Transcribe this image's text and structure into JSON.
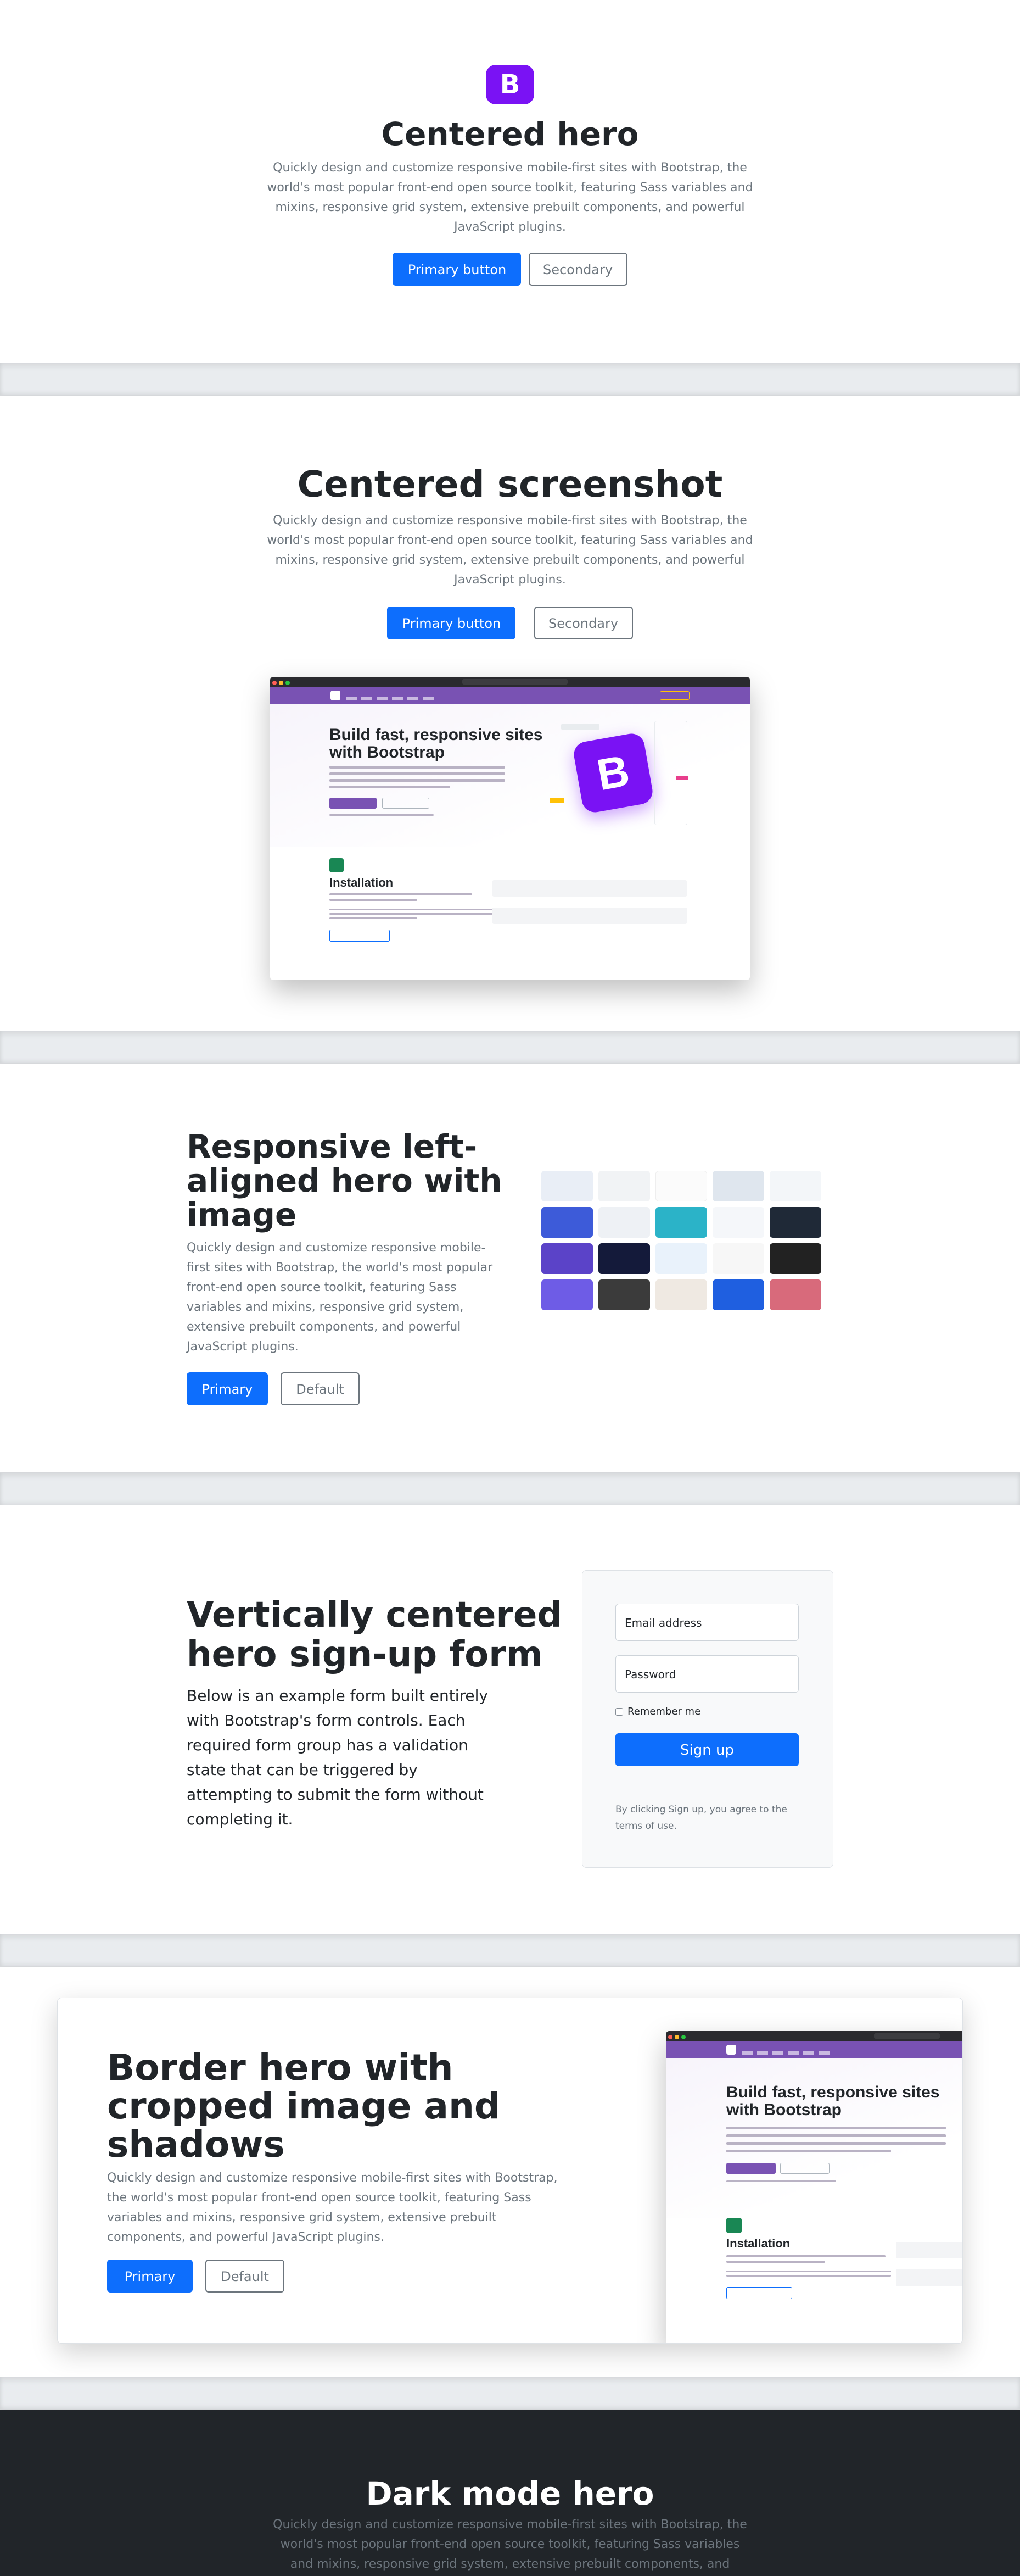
{
  "hero1": {
    "logo_letter": "B",
    "title": "Centered hero",
    "lead_lines": [
      "Quickly design and customize responsive mobile-first sites with Bootstrap, the",
      "world's most popular front-end open source toolkit, featuring Sass variables and",
      "mixins, responsive grid system, extensive prebuilt components, and powerful",
      "JavaScript plugins."
    ],
    "primary_label": "Primary button",
    "secondary_label": "Secondary"
  },
  "hero2": {
    "title": "Centered screenshot",
    "lead_lines": [
      "Quickly design and customize responsive mobile-first sites with Bootstrap, the",
      "world's most popular front-end open source toolkit, featuring Sass variables and",
      "mixins, responsive grid system, extensive prebuilt components, and powerful",
      "JavaScript plugins."
    ],
    "primary_label": "Primary button",
    "secondary_label": "Secondary",
    "screenshot": {
      "headline_1": "Build fast, responsive sites",
      "headline_2": "with Bootstrap",
      "section_title": "Installation",
      "logo_letter": "B"
    }
  },
  "hero3": {
    "title_lines": [
      "Responsive left-",
      "aligned hero with",
      "image"
    ],
    "lead_lines": [
      "Quickly design and customize responsive mobile-",
      "first sites with Bootstrap, the world's most popular",
      "front-end open source toolkit, featuring Sass",
      "variables and mixins, responsive grid system,",
      "extensive prebuilt components, and powerful",
      "JavaScript plugins."
    ],
    "primary_label": "Primary",
    "default_label": "Default"
  },
  "hero4": {
    "title_lines": [
      "Vertically centered",
      "hero sign-up form"
    ],
    "lead_lines": [
      "Below is an example form built entirely",
      "with Bootstrap's form controls. Each",
      "required form group has a validation",
      "state that can be triggered by",
      "attempting to submit the form without",
      "completing it."
    ],
    "email_placeholder": "Email address",
    "password_placeholder": "Password",
    "remember_label": "Remember me",
    "signup_label": "Sign up",
    "terms_lines": [
      "By clicking Sign up, you agree to the",
      "terms of use."
    ]
  },
  "hero5": {
    "title_lines": [
      "Border hero with",
      "cropped image and",
      "shadows"
    ],
    "lead_lines": [
      "Quickly design and customize responsive mobile-first sites with Bootstrap,",
      "the world's most popular front-end open source toolkit, featuring Sass",
      "variables and mixins, responsive grid system, extensive prebuilt",
      "components, and powerful JavaScript plugins."
    ],
    "primary_label": "Primary",
    "default_label": "Default",
    "screenshot": {
      "headline_1": "Build fast, responsive sites",
      "headline_2": "with Bootstrap",
      "section_title": "Installation"
    }
  },
  "hero6": {
    "title": "Dark mode hero",
    "lead_lines": [
      "Quickly design and customize responsive mobile-first sites with Bootstrap, the",
      "world's most popular front-end open source toolkit, featuring Sass variables",
      "and mixins, responsive grid system, extensive prebuilt components, and"
    ]
  },
  "colors": {
    "primary": "#0d6efd",
    "brand": "#7a12f4",
    "dark_bg": "#212529"
  }
}
